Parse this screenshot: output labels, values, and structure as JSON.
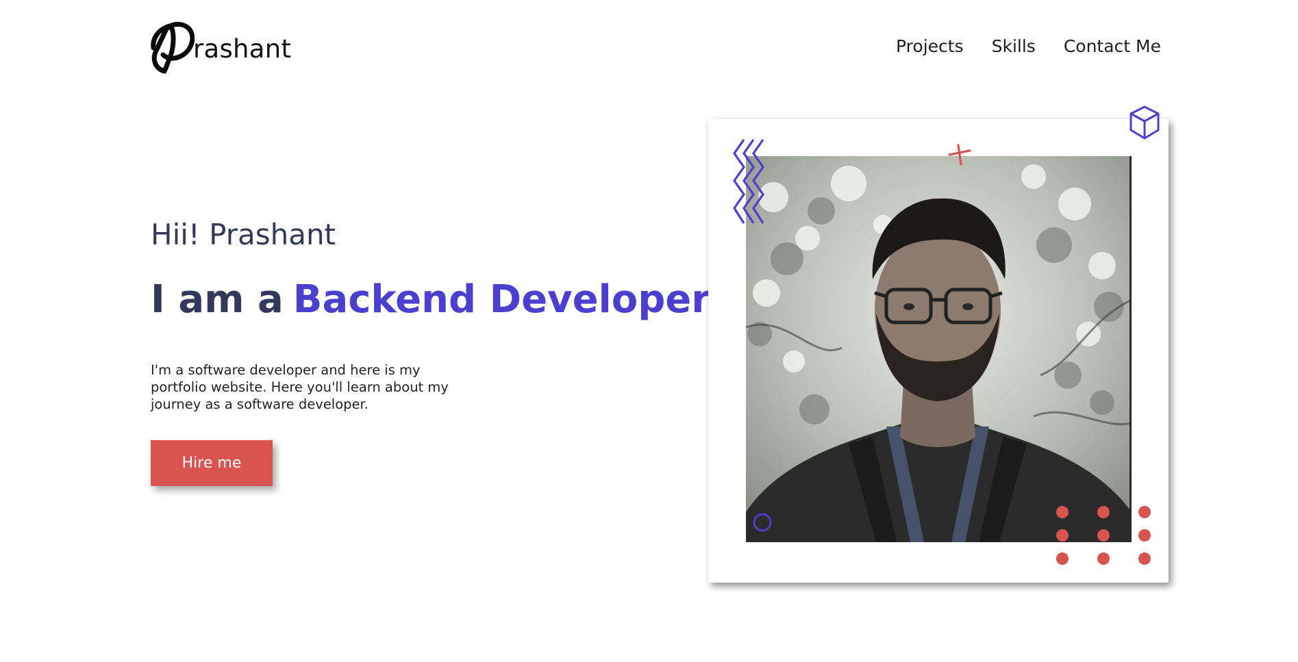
{
  "header": {
    "logo_text": "rashant",
    "nav": [
      "Projects",
      "Skills",
      "Contact Me"
    ]
  },
  "hero": {
    "greeting": "Hii! Prashant",
    "role_prefix": "I am a",
    "role": "Backend Developer",
    "bio": "I'm a software developer and here is my portfolio website. Here you'll learn about my journey as a software developer.",
    "cta": "Hire me"
  },
  "colors": {
    "accent": "#4b3fcf",
    "cta": "#d9534f",
    "heading": "#33395a"
  },
  "icons": [
    "logo-p-icon",
    "zigzag-decoration",
    "cross-decoration",
    "cube-icon",
    "circle-decoration",
    "dots-grid-decoration"
  ]
}
